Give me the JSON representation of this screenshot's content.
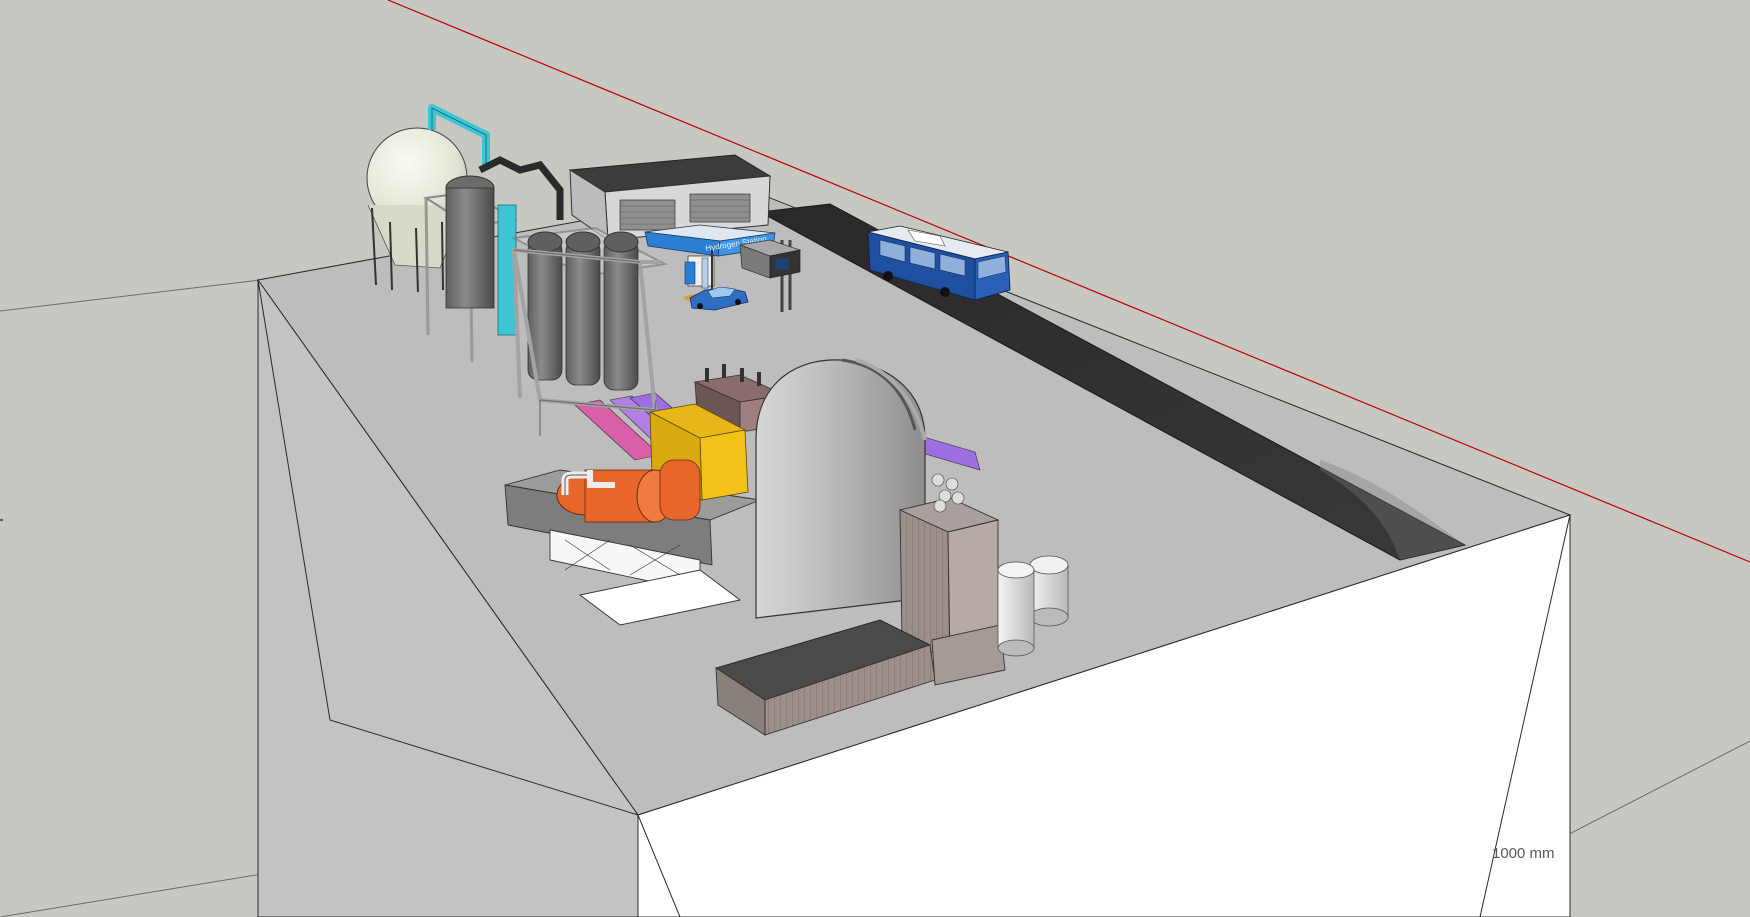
{
  "viewport": {
    "background": "#c8c8c3",
    "dimension_label": "1000 mm",
    "axis_colors": {
      "red_axis": "#c00000",
      "ground_lines": "#6b6b6b"
    }
  },
  "model": {
    "sign_text": "Hydrogen Station",
    "components": [
      "spherical-tank",
      "hydrogen-storage-cylinders",
      "hydrogen-station-canopy",
      "garage-building",
      "fuel-cell-bus",
      "car",
      "truck",
      "road",
      "reactor-containment-dome",
      "turbine-generator",
      "transformer",
      "water-tanks",
      "auxiliary-building"
    ],
    "colors": {
      "plinth_top": "#bdbdbd",
      "plinth_front": "#ffffff",
      "plinth_left": "#c3c3c3",
      "road": "#2e2c2c",
      "dome": "#b8b8b8",
      "turbine": "#e8662a",
      "generator_frame": "#f2c21a",
      "bus": "#1f4fa0",
      "canopy": "#2a7fd4",
      "building_wall": "#9c8f8a",
      "pipes_purple": "#9b6fe0",
      "pipes_pink": "#d85fa8",
      "pipes_cyan": "#3fc8d8"
    }
  }
}
